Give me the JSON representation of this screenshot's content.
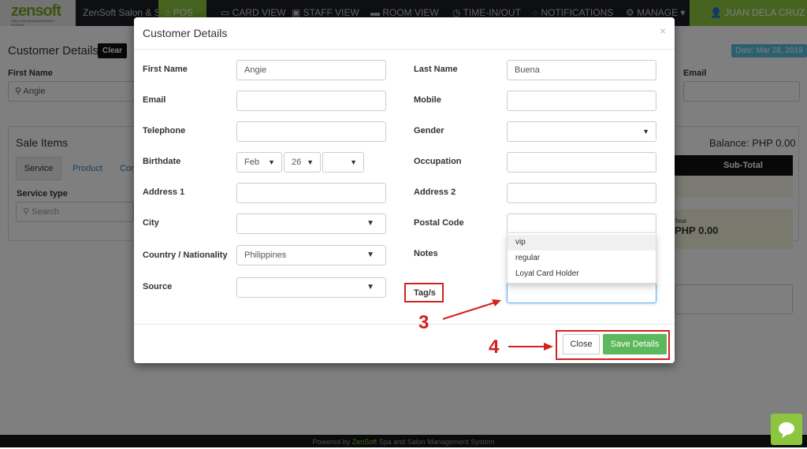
{
  "nav": {
    "logo": "zensoft",
    "logo_sub": "SPA & SALON MANAGEMENT SYSTEM",
    "brand": "ZenSoft Salon & Spa",
    "items": [
      {
        "label": "POS",
        "icon": "cart-icon"
      },
      {
        "label": "CARD VIEW",
        "icon": "card-icon"
      },
      {
        "label": "STAFF VIEW",
        "icon": "staff-icon"
      },
      {
        "label": "ROOM VIEW",
        "icon": "room-icon"
      },
      {
        "label": "TIME-IN/OUT",
        "icon": "clock-icon"
      },
      {
        "label": "NOTIFICATIONS",
        "icon": "bell-icon"
      },
      {
        "label": "MANAGE ▾",
        "icon": "gear-icon"
      }
    ],
    "user": "JUAN DELA CRUZ ▾"
  },
  "page": {
    "title": "Customer Details",
    "clear": "Clear",
    "date": "Date: Mar 28, 2019",
    "first_name_label": "First Name",
    "first_name_value": "Angie",
    "email_label": "Email",
    "sale_items": "Sale Items",
    "tabs": [
      "Service",
      "Product",
      "Con"
    ],
    "service_type": "Service type",
    "search_placeholder": "Search",
    "balance": "Balance: PHP 0.00",
    "subtotal": "Sub-Total",
    "total_label": "Total",
    "total_value": "PHP 0.00"
  },
  "modal": {
    "title": "Customer Details",
    "close_x": "×",
    "left": [
      {
        "label": "First Name",
        "value": "Angie"
      },
      {
        "label": "Email",
        "value": ""
      },
      {
        "label": "Telephone",
        "value": ""
      },
      {
        "label": "Birthdate"
      },
      {
        "label": "Address 1",
        "value": ""
      },
      {
        "label": "City",
        "value": ""
      },
      {
        "label": "Country / Nationality",
        "value": "Philippines"
      },
      {
        "label": "Source",
        "value": ""
      }
    ],
    "birth": {
      "month": "Feb",
      "day": "26",
      "year": ""
    },
    "right": [
      {
        "label": "Last Name",
        "value": "Buena"
      },
      {
        "label": "Mobile",
        "value": ""
      },
      {
        "label": "Gender",
        "value": ""
      },
      {
        "label": "Occupation",
        "value": ""
      },
      {
        "label": "Address 2",
        "value": ""
      },
      {
        "label": "Postal Code",
        "value": ""
      },
      {
        "label": "Notes"
      },
      {
        "label": "Tag/s"
      }
    ],
    "tag_options": [
      "vip",
      "regular",
      "Loyal Card Holder"
    ],
    "close_btn": "Close",
    "save_btn": "Save Details"
  },
  "annotations": {
    "step3": "3",
    "step4": "4"
  },
  "footer": {
    "pre": "Powered by ",
    "brand": "ZenSoft",
    "post": " Spa and Salon Management System"
  },
  "colors": {
    "accent": "#8cc63f",
    "save": "#5cb85c",
    "annotation": "#d62020",
    "badge": "#5bc0de"
  }
}
